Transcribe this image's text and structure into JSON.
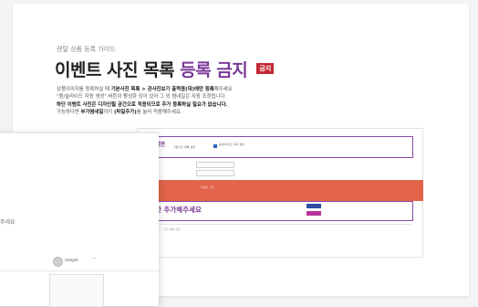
{
  "guide": {
    "subtitle": "렌탈 상품 등록 가이드",
    "title_main": "이벤트 사진 목록",
    "title_highlight": "등록 금지",
    "badge": "금지",
    "desc_line1_a": "상품이미지를 등록하실 때 ",
    "desc_line1_strong": "기본사진 목록 > 관사진보기 출력용(대)에만 등록",
    "desc_line1_b": "해주세요",
    "desc_line2": "\"줌/슬라이드 자동 생성\" 버튼이 활성화 되어 있어 그 외 썸네일은 자동 조정됩니다.",
    "desc_line3_strong": "하단 이벤트 사진은 디자인될 공간으로 적용되므로 추가 등록하실 필요가 없습니다.",
    "desc_line4_a": "가능하다면 ",
    "desc_line4_strong1": "부가썸네일",
    "desc_line4_b": "까지 ",
    "desc_line4_strong2": "(파일추가)",
    "desc_line4_c": "를 눌러 적용해주세요."
  },
  "admin": {
    "box1_fragment": "기안",
    "box1_tiny": "기본사진 목록 설정",
    "box1_tiny_right": "줌/슬라이드 자동 생성",
    "red_fragment": "금지",
    "red_tiny": "이벤트 사진",
    "box2_fragment": "한 추가해주세요",
    "lower_text": "사진 목록 설정"
  },
  "front": {
    "fragment": "주세요",
    "name": "sample",
    "dots": "···"
  },
  "colors": {
    "purple": "#7a3896",
    "badge_red": "#c32732",
    "band_orange": "#e2644a",
    "btn_blue": "#2e4ea3",
    "btn_pink": "#b5339b"
  }
}
